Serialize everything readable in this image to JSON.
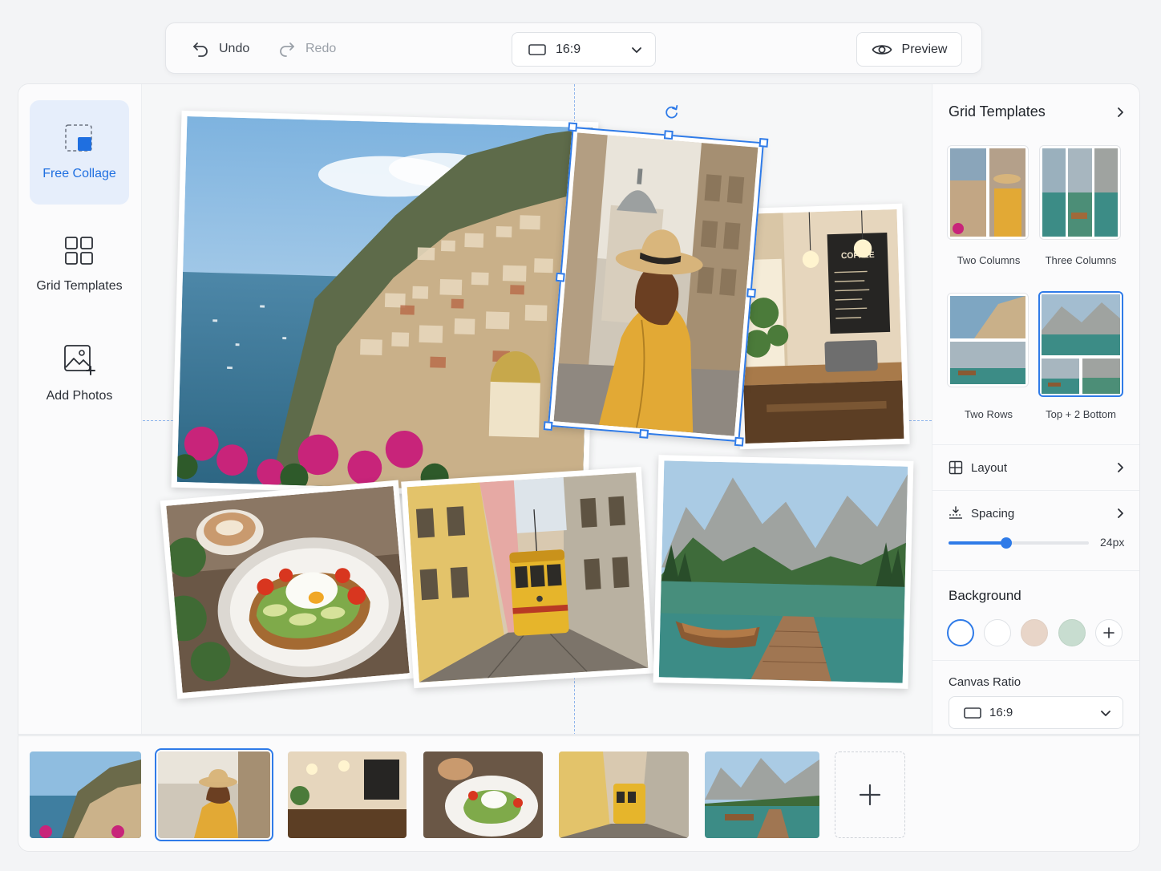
{
  "toolbar": {
    "undo_label": "Undo",
    "redo_label": "Redo",
    "ratio_value": "16:9",
    "preview_label": "Preview"
  },
  "sidebar": {
    "items": [
      {
        "label": "Free Collage",
        "icon": "free-collage-icon",
        "active": true
      },
      {
        "label": "Grid Templates",
        "icon": "grid-icon",
        "active": false
      },
      {
        "label": "Add Photos",
        "icon": "add-photo-icon",
        "active": false
      }
    ]
  },
  "canvas": {
    "photos": [
      {
        "subject": "positano-coast"
      },
      {
        "subject": "woman-straw-hat",
        "selected": true
      },
      {
        "subject": "coffee-shop"
      },
      {
        "subject": "avocado-toast"
      },
      {
        "subject": "lisbon-tram"
      },
      {
        "subject": "mountain-lake-boat"
      }
    ]
  },
  "panel": {
    "grid_templates_title": "Grid Templates",
    "templates": [
      {
        "label": "Two Columns",
        "active": false
      },
      {
        "label": "Three Columns",
        "active": false
      },
      {
        "label": "Two Rows",
        "active": false
      },
      {
        "label": "Top + 2 Bottom",
        "active": true
      }
    ],
    "layout_label": "Layout",
    "spacing_label": "Spacing",
    "spacing_value": "24px",
    "spacing_level": 0.41,
    "background_label": "Background",
    "background_colors": [
      "#ffffff",
      "#ffffff",
      "#e8d5c8",
      "#c8ddd0"
    ],
    "canvas_ratio_label": "Canvas Ratio",
    "canvas_ratio_value": "16:9"
  },
  "filmstrip": {
    "thumbs": [
      {
        "subject": "positano-coast",
        "active": false
      },
      {
        "subject": "woman-straw-hat",
        "active": true
      },
      {
        "subject": "coffee-shop",
        "active": false
      },
      {
        "subject": "avocado-toast",
        "active": false
      },
      {
        "subject": "lisbon-tram",
        "active": false
      },
      {
        "subject": "mountain-lake-boat",
        "active": false
      }
    ]
  },
  "colors": {
    "accent": "#2f7be8",
    "active_bg": "#e6eefb"
  }
}
